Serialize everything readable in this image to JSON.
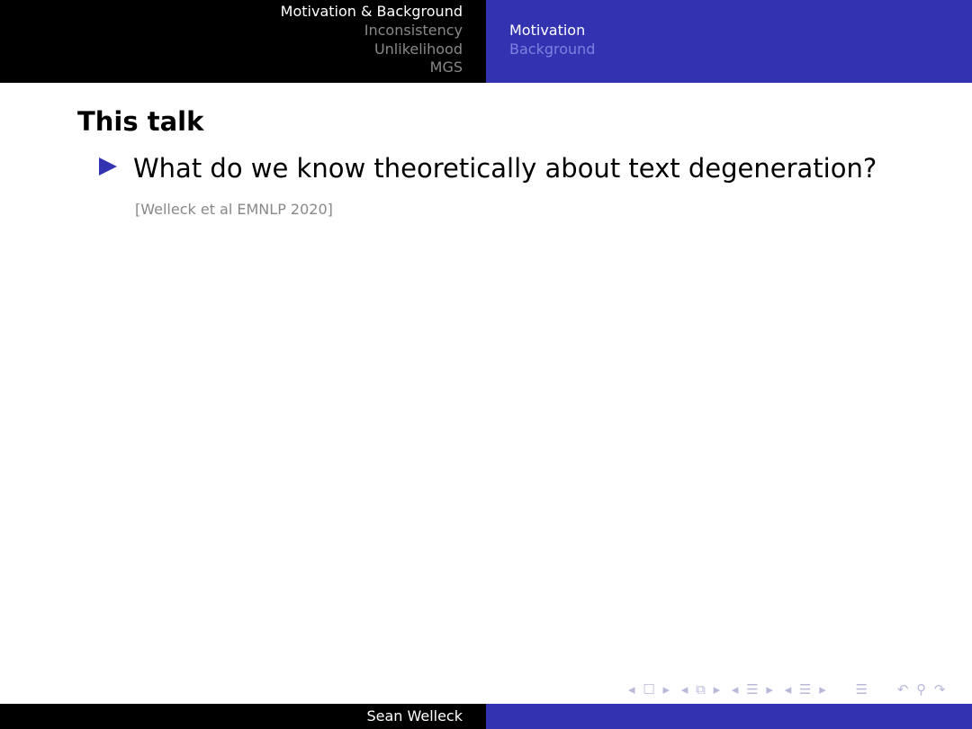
{
  "header": {
    "sections": [
      "Motivation & Background",
      "Inconsistency",
      "Unlikelihood",
      "MGS"
    ],
    "subsections": [
      "Motivation",
      "Background"
    ]
  },
  "slide": {
    "title": "This talk",
    "bullet": "What do we know theoretically about text degeneration?",
    "citation": "[Welleck et al EMNLP 2020]"
  },
  "footer": {
    "author": "Sean Welleck"
  },
  "nav": {
    "frame": "◂ ☐ ▸",
    "subsection": "◂ ⧉ ▸",
    "section": "◂ ☰ ▸",
    "sub": "◂ ☰ ▸",
    "align": "☰",
    "search": "↶ ⚲ ↷"
  }
}
